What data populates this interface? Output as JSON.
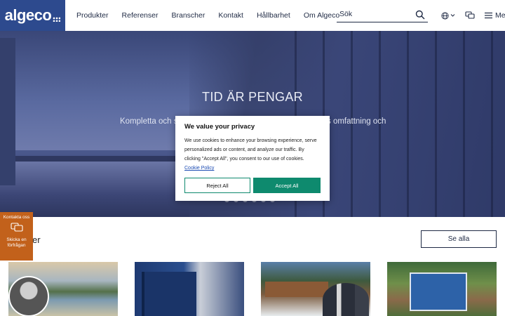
{
  "header": {
    "logo": "algeco",
    "nav": [
      "Produkter",
      "Referenser",
      "Branscher",
      "Kontakt",
      "Hållbarhet",
      "Om Algeco"
    ],
    "search_placeholder": "Sök",
    "menu_label": "Meny"
  },
  "hero": {
    "title": "TID ÄR PENGAR",
    "subtitle_left": "Kompletta och s",
    "subtitle_right": "s omfattning och",
    "slide_count": 6
  },
  "cookie": {
    "title": "We value your privacy",
    "text": "We use cookies to enhance your browsing experience, serve personalized ads or content, and analyze our traffic. By clicking \"Accept All\", you consent to our use of cookies.",
    "policy_link": "Cookie Policy",
    "reject_label": "Reject All",
    "accept_label": "Accept All"
  },
  "content": {
    "section_title_partial": "er",
    "see_all_label": "Se alla",
    "cards": [
      "card-1",
      "card-2",
      "card-3",
      "card-4"
    ]
  },
  "side_tab": {
    "top_label": "Kontakta oss",
    "bottom_label": "Skicka en förfrågan"
  },
  "colors": {
    "brand_blue": "#2d4a8e",
    "accent_green": "#0e8a6e",
    "side_tab_orange": "#c2611b"
  }
}
